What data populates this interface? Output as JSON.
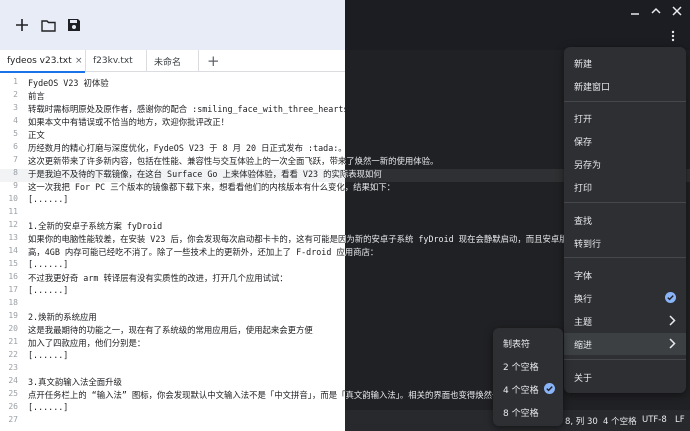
{
  "toolbar": {
    "new_icon": "plus-icon",
    "open_icon": "folder-icon",
    "save_icon": "floppy-icon"
  },
  "tabs": [
    {
      "label": "fydeos v23.txt",
      "close": "×"
    },
    {
      "label": "f23kv.txt"
    },
    {
      "label": "未命名"
    }
  ],
  "tab_add": "+",
  "gutter": [
    "1",
    "2",
    "3",
    "4",
    "5",
    "6",
    "7",
    "8",
    "9",
    "10",
    "11",
    "12",
    "13",
    "14",
    "15",
    "16",
    "17",
    "18",
    "19",
    "20",
    "21",
    "22",
    "23",
    "24",
    "25",
    "26",
    "27"
  ],
  "lines": [
    "FydeOS V23 初体验",
    "前言",
    "转载时需标明原处及原作者，感谢你的配合 :smiling_face_with_three_hearts:",
    "如果本文中有错误或不恰当的地方，欢迎你批评改正！",
    "正文",
    "历经数月的精心打磨与深度优化，FydeOS V23 于 8 月 20 日正式发布 :tada:。",
    "这次更新带来了许多新内容，包括在性能、兼容性与交互体验上的一次全面飞跃，带来了焕然一新的使用体验。",
    "于是我迫不及待的下载镜像，在这台 Surface Go 上来体验体验，看看 V23 的实际表现如何",
    "这一次我把 For PC 三个版本的镜像都下载下来，想看看他们的内核版本有什么变化，结果如下：",
    "[......]",
    "",
    "1.全新的安卓子系统方案 fyDroid",
    "如果你的电脑性能较差，在安装 V23 后，你会发现每次启动都卡卡的，这有可能是因为新的安卓子系统 fyDroid 现在会静默启动，而且安卓版本全都",
    "高，4GB 内存可能已经吃不消了。除了一些技术上的更新外，还加上了 F-droid 应用商店：",
    "[......]",
    "不过我更好奇 arm 转译层有没有实质性的改进，打开几个应用试试：",
    "[......]",
    "",
    "2.焕新的系统应用",
    "这是我最期待的功能之一，现在有了系统级的常用应用后，使用起来会更方便",
    "加入了四款应用，他们分别是：",
    "[......]",
    "",
    "3.真文韵输入法全面升级",
    "点开任务栏上的 “输入法” 图标，你会发现默认中文输入法不是「中文拼音」，而是「真文韵输入法」。相关的界面也变得焕然一新",
    "[......]",
    ""
  ],
  "status": {
    "position": "8, 列 30",
    "indent": "4 个空格",
    "encoding": "UTF-8",
    "eol": "LF"
  },
  "menu": {
    "items": [
      {
        "label": "新建"
      },
      {
        "label": "新建窗口"
      },
      {
        "label": "打开"
      },
      {
        "label": "保存"
      },
      {
        "label": "另存为"
      },
      {
        "label": "打印"
      },
      {
        "label": "查找"
      },
      {
        "label": "转到行"
      },
      {
        "label": "字体"
      },
      {
        "label": "换行",
        "icon": "check-circle-icon"
      },
      {
        "label": "主题",
        "icon": "chevron-right-icon"
      },
      {
        "label": "缩进",
        "icon": "chevron-right-icon"
      },
      {
        "label": "关于"
      }
    ]
  },
  "indent_menu": {
    "items": [
      {
        "label": "制表符"
      },
      {
        "label": "2 个空格"
      },
      {
        "label": "4 个空格",
        "icon": "check-circle-icon"
      },
      {
        "label": "8 个空格"
      }
    ]
  },
  "colors": {
    "accent": "#1a73e8",
    "dark_bg": "#202124",
    "menu_bg": "#2d2f33"
  }
}
